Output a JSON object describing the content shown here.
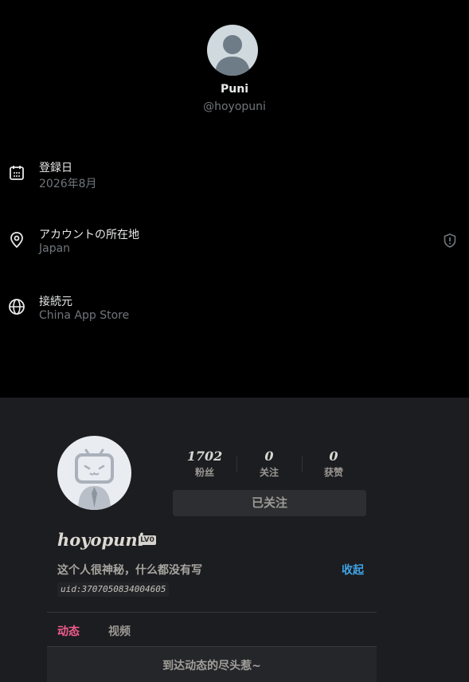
{
  "account": {
    "display_name": "Puni",
    "handle": "@hoyopuni",
    "rows": [
      {
        "label": "登録日",
        "value": "2026年8月",
        "icon": "calendar-icon"
      },
      {
        "label": "アカウントの所在地",
        "value": "Japan",
        "icon": "location-pin-icon",
        "trailing_icon": "shield-alert-icon"
      },
      {
        "label": "接続元",
        "value": "China App Store",
        "icon": "globe-icon"
      }
    ]
  },
  "bilibili": {
    "stats": [
      {
        "value": "1702",
        "label": "粉丝"
      },
      {
        "value": "0",
        "label": "关注"
      },
      {
        "value": "0",
        "label": "获赞"
      }
    ],
    "follow_button": "已关注",
    "username": "hoyopuni",
    "level_badge": "LV0",
    "signature": "这个人很神秘，什么都没有写",
    "collapse_link": "收起",
    "uid": "uid:3707050834004605",
    "tabs": [
      "动态",
      "视频"
    ],
    "end_message": "到达动态的尽头惹~",
    "colors": {
      "accent_pink": "#f25d8e",
      "link_blue": "#3ea3e6"
    }
  }
}
